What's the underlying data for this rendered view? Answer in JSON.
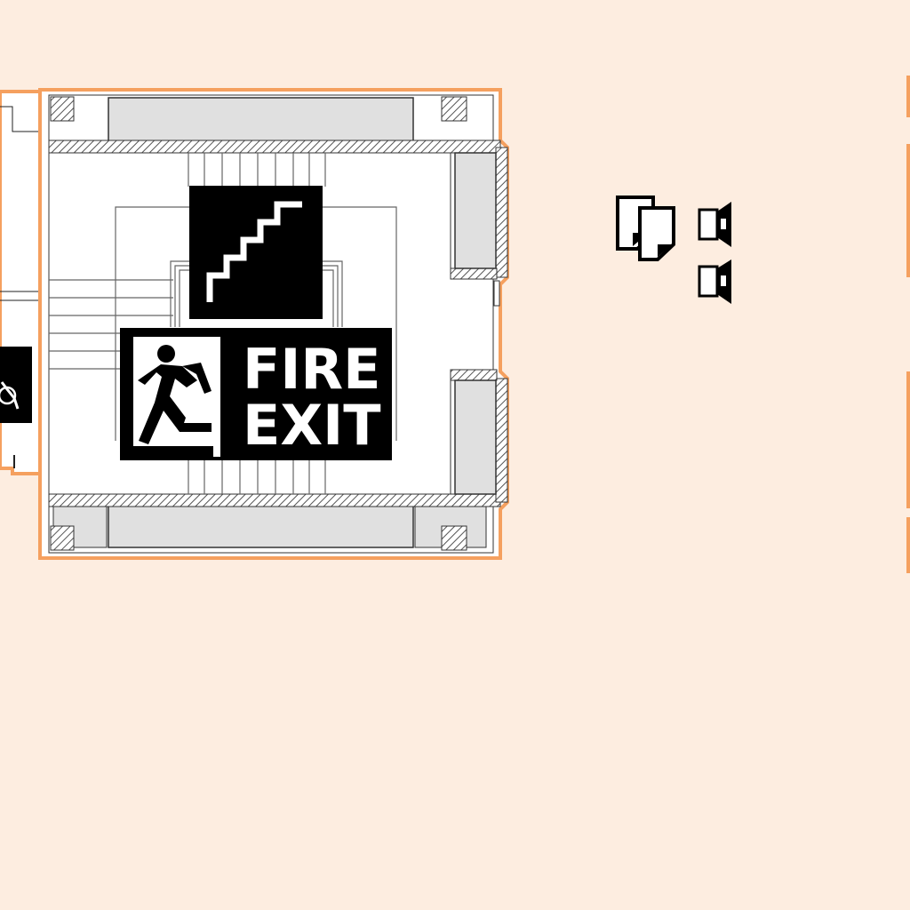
{
  "map": {
    "background_color": "#fdede0",
    "wall_outline_color": "#f5a05f",
    "hatch_color": "#555555",
    "fill_gray": "#e0e0e0"
  },
  "fire_exit_sign": {
    "line1": "FIRE",
    "line2": "EXIT"
  },
  "icons": [
    "stairs-icon",
    "running-person-icon",
    "documents-icon",
    "speaker-icon",
    "wheelchair-icon"
  ]
}
